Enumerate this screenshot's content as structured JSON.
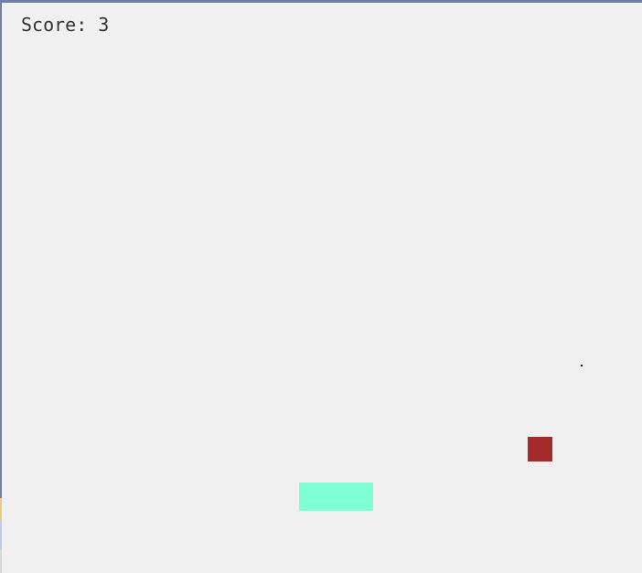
{
  "hud": {
    "score_text": "Score: 3"
  },
  "colors": {
    "background": "#f0f0f0",
    "paddle": "#7fffd4",
    "enemy_block": "#a52a2a",
    "ball": "#0000cc",
    "score_text": "#333333"
  },
  "objects": {
    "paddle_icon": "player-paddle",
    "block_icon": "falling-block",
    "ball_icon": "ball-dot"
  }
}
